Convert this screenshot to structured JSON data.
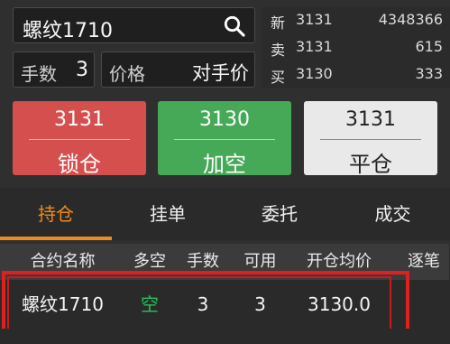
{
  "search": {
    "value": "螺纹1710",
    "icon": "search-icon"
  },
  "quantity": {
    "label": "手数",
    "value": "3"
  },
  "price": {
    "label": "价格",
    "value": "对手价"
  },
  "quotes": [
    {
      "key": "新",
      "price": "3131",
      "volume": "4348366"
    },
    {
      "key": "卖",
      "price": "3131",
      "volume": "615"
    },
    {
      "key": "买",
      "price": "3130",
      "volume": "333"
    }
  ],
  "actions": [
    {
      "price": "3131",
      "label": "锁仓",
      "color": "#e25555"
    },
    {
      "price": "3130",
      "label": "加空",
      "color": "#4aa85a"
    },
    {
      "price": "3131",
      "label": "平仓",
      "color": "#e9e9e9"
    }
  ],
  "tabs": [
    {
      "label": "持仓",
      "active": true
    },
    {
      "label": "挂单"
    },
    {
      "label": "委托"
    },
    {
      "label": "成交"
    }
  ],
  "table": {
    "headers": [
      "合约名称",
      "多空",
      "手数",
      "可用",
      "开仓均价",
      "逐笔"
    ],
    "rows": [
      [
        "螺纹1710",
        "空",
        "3",
        "3",
        "3130.0",
        ""
      ]
    ]
  },
  "colors": {
    "accent": "#f08a1c",
    "short": "#24c35a",
    "highlight": "#e01f1f"
  }
}
